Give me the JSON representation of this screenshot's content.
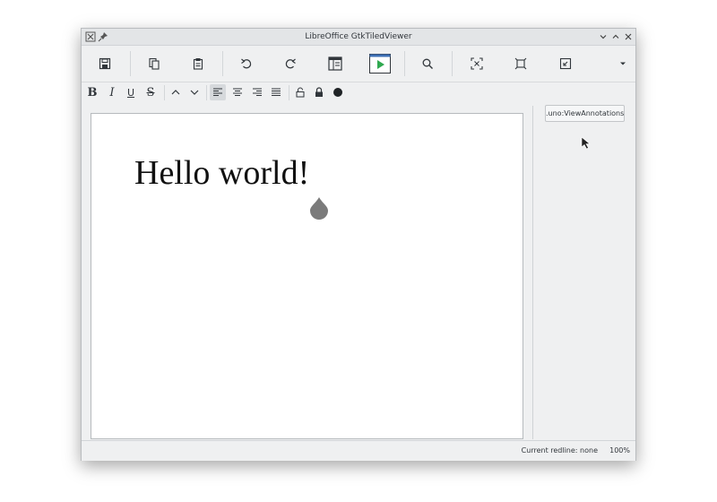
{
  "window": {
    "title": "LibreOffice GtkTiledViewer"
  },
  "toolbar": {
    "buttons": [
      "save-icon",
      "copy-icon",
      "paste-icon",
      "undo-icon",
      "redo-icon",
      "sidebar-icon",
      "presentation-icon",
      "search-icon",
      "zoom-fit-icon",
      "zoom-original-icon",
      "zoom-shrink-icon",
      "overflow-icon"
    ]
  },
  "format": {
    "bold": "B",
    "italic": "I",
    "underline": "U",
    "strikethrough": "S"
  },
  "document": {
    "text": "Hello world!"
  },
  "side": {
    "uno_button": ".uno:ViewAnnotations"
  },
  "status": {
    "redline": "Current redline: none",
    "zoom": "100%"
  },
  "colors": {
    "accent_green": "#2fa84f",
    "window_bg": "#eff0f1"
  }
}
